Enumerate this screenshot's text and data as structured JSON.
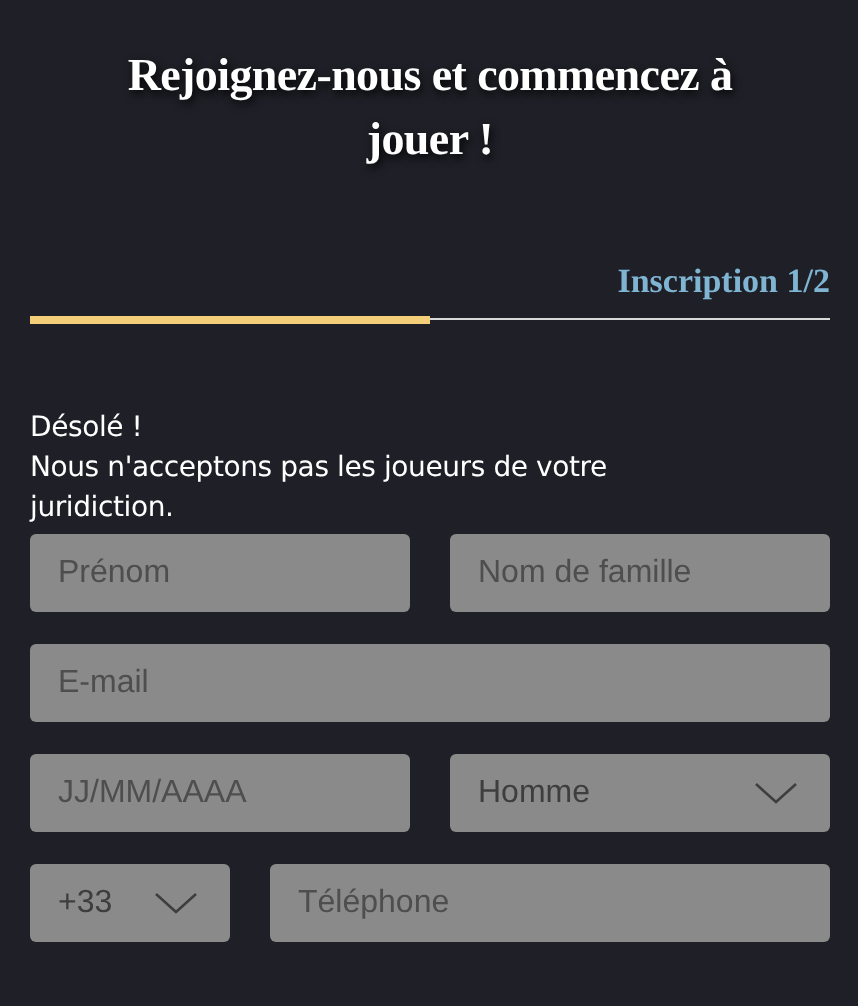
{
  "title": "Rejoignez-nous et commencez à jouer !",
  "progress": {
    "label": "Inscription 1/2",
    "level": 0.5
  },
  "message": {
    "heading": "Désolé !",
    "text": "Nous n'acceptons pas les joueurs de votre juridiction."
  },
  "form": {
    "rows": [
      [
        {
          "kind": "text",
          "placeholder": "Prénom"
        },
        {
          "kind": "text",
          "placeholder": "Nom de famille"
        }
      ],
      [
        {
          "kind": "text",
          "placeholder": "E-mail"
        }
      ],
      [
        {
          "kind": "text",
          "placeholder": "JJ/MM/AAAA"
        },
        {
          "kind": "select",
          "value": "Homme"
        }
      ],
      [
        {
          "kind": "code-select",
          "value": "+33"
        },
        {
          "kind": "text",
          "placeholder": "Téléphone"
        }
      ]
    ]
  }
}
